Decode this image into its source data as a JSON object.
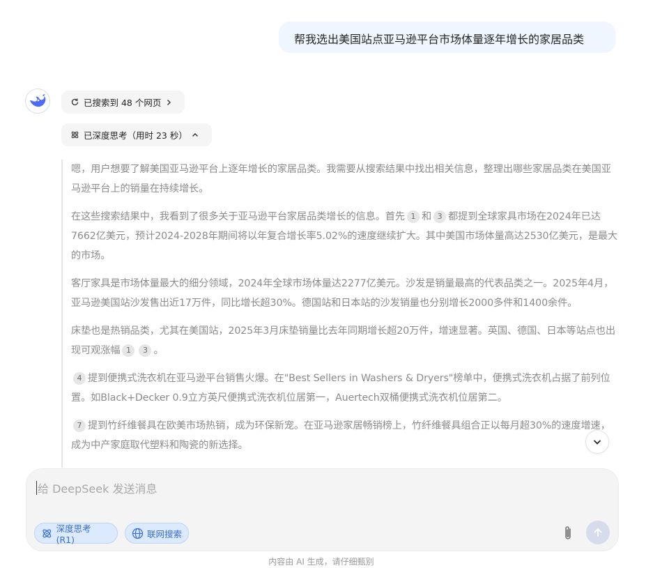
{
  "user_message": "帮我选出美国站点亚马逊平台市场体量逐年增长的家居品类",
  "assistant": {
    "avatar_icon": "deepseek-whale-icon",
    "search_pill": {
      "label": "已搜索到 48 个网页",
      "icon": "refresh-icon",
      "chevron": "chevron-right-icon"
    },
    "think_pill": {
      "label": "已深度思考（用时 23 秒）",
      "icon": "atom-icon",
      "chevron": "chevron-up-icon"
    },
    "thinking": {
      "p1": "嗯，用户想要了解美国亚马逊平台上逐年增长的家居品类。我需要从搜索结果中找出相关信息，整理出哪些家居品类在美国亚马逊平台上的销量在持续增长。",
      "p2_a": "在这些搜索结果中，我看到了很多关于亚马逊平台家居品类增长的信息。首先",
      "p2_cite1": "1",
      "p2_and": "和",
      "p2_cite2": "3",
      "p2_b": "都提到全球家具市场在2024年已达7662亿美元，预计2024-2028年期间将以年复合增长率5.02%的速度继续扩大。其中美国市场体量高达2530亿美元，是最大的市场。",
      "p3": "客厅家具是市场体量最大的细分领域，2024年全球市场体量达2277亿美元。沙发是销量最高的代表品类之一。2025年4月，亚马逊美国站沙发售出近17万件，同比增长超30%。德国站和日本站的沙发销量也分别增长2000多件和1400余件。",
      "p4_a": "床垫也是热销品类，尤其在美国站，2025年3月床垫销量比去年同期增长超20万件，增速显著。英国、德国、日本等站点也出现可观涨幅",
      "p4_cite1": "1",
      "p4_cite2": "3",
      "p4_end": "。",
      "p5_cite": "4",
      "p5": "提到便携式洗衣机在亚马逊平台销售火爆。在\"Best Sellers in Washers & Dryers\"榜单中，便携式洗衣机占据了前列位置。如Black+Decker 0.9立方英尺便携式洗衣机位居第一，Auertech双桶便携式洗衣机位居第二。",
      "p6_cite": "7",
      "p6": "提到竹纤维餐具在欧美市场热销，成为环保新宠。在亚马逊家居畅销榜上，竹纤维餐具组合正以每月超30%的速度增速，成为中产家庭取代塑料和陶瓷的新选择。"
    }
  },
  "composer": {
    "placeholder": "给 DeepSeek 发送消息",
    "deep_think_label": "深度思考 (R1)",
    "web_search_label": "联网搜索",
    "attach_icon": "paperclip-icon",
    "send_icon": "arrow-up-icon"
  },
  "footer_note": "内容由 AI 生成，请仔细甄别",
  "colors": {
    "user_bubble": "#eff6ff",
    "accent_blue": "#3b6fd4",
    "chip_bg": "#dbeafe",
    "thinking_text": "#8b8b8b"
  }
}
